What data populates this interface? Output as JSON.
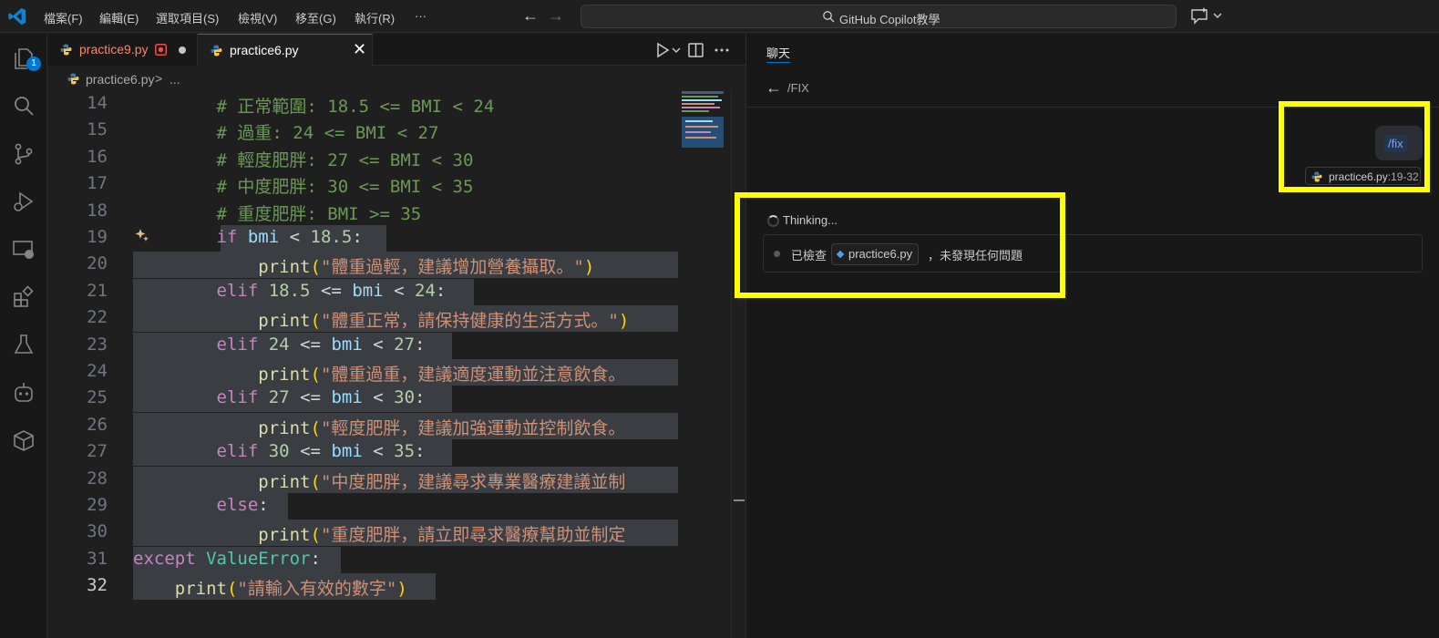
{
  "titlebar": {
    "menus": [
      "檔案(F)",
      "編輯(E)",
      "選取項目(S)",
      "檢視(V)",
      "移至(G)",
      "執行(R)",
      "···"
    ],
    "command_center": "GitHub Copilot教學"
  },
  "activity_bar": {
    "icons": [
      "explorer-icon",
      "search-icon",
      "source-control-icon",
      "run-debug-icon",
      "remote-explorer-icon",
      "extensions-icon",
      "testing-icon",
      "copilot-icon",
      "containers-icon"
    ],
    "explorer_badge": "1"
  },
  "tabs": [
    {
      "label": "practice9.py",
      "state": "error",
      "dirty": true
    },
    {
      "label": "practice6.py",
      "state": "active"
    }
  ],
  "breadcrumb": {
    "file": "practice6.py",
    "separator": ">",
    "more": "..."
  },
  "editor": {
    "lines": [
      {
        "n": "14",
        "code": "        # 正常範圍: 18.5 <= BMI < 24"
      },
      {
        "n": "15",
        "code": "        # 過重: 24 <= BMI < 27"
      },
      {
        "n": "16",
        "code": "        # 輕度肥胖: 27 <= BMI < 30"
      },
      {
        "n": "17",
        "code": "        # 中度肥胖: 30 <= BMI < 35"
      },
      {
        "n": "18",
        "code": "        # 重度肥胖: BMI >= 35"
      },
      {
        "n": "19",
        "code": "        if bmi < 18.5:"
      },
      {
        "n": "20",
        "code": "            print(\"體重過輕，建議增加營養攝取。\")"
      },
      {
        "n": "21",
        "code": "        elif 18.5 <= bmi < 24:"
      },
      {
        "n": "22",
        "code": "            print(\"體重正常，請保持健康的生活方式。\")"
      },
      {
        "n": "23",
        "code": "        elif 24 <= bmi < 27:"
      },
      {
        "n": "24",
        "code": "            print(\"體重過重，建議適度運動並注意飲食。"
      },
      {
        "n": "25",
        "code": "        elif 27 <= bmi < 30:"
      },
      {
        "n": "26",
        "code": "            print(\"輕度肥胖，建議加強運動並控制飲食。"
      },
      {
        "n": "27",
        "code": "        elif 30 <= bmi < 35:"
      },
      {
        "n": "28",
        "code": "            print(\"中度肥胖，建議尋求專業醫療建議並制"
      },
      {
        "n": "29",
        "code": "        else:"
      },
      {
        "n": "30",
        "code": "            print(\"重度肥胖，請立即尋求醫療幫助並制定"
      },
      {
        "n": "31",
        "code": "except ValueError:"
      },
      {
        "n": "32",
        "code": "    print(\"請輸入有效的數字\")"
      }
    ],
    "active_line": "32"
  },
  "chat": {
    "tab_label": "聊天",
    "header_title": "/FIX",
    "user_message": "/fix",
    "reference_file": "practice6.py",
    "reference_range": ":19-32",
    "status": "Thinking...",
    "progress_prefix": "已檢查",
    "progress_file": "practice6.py",
    "progress_suffix": "，未發現任何問題"
  },
  "colors": {
    "accent": "#0078d4",
    "highlight_box": "#ffff00",
    "error_tab": "#f48771",
    "comment": "#6a9955",
    "keyword": "#c586c0",
    "string": "#ce9178"
  }
}
